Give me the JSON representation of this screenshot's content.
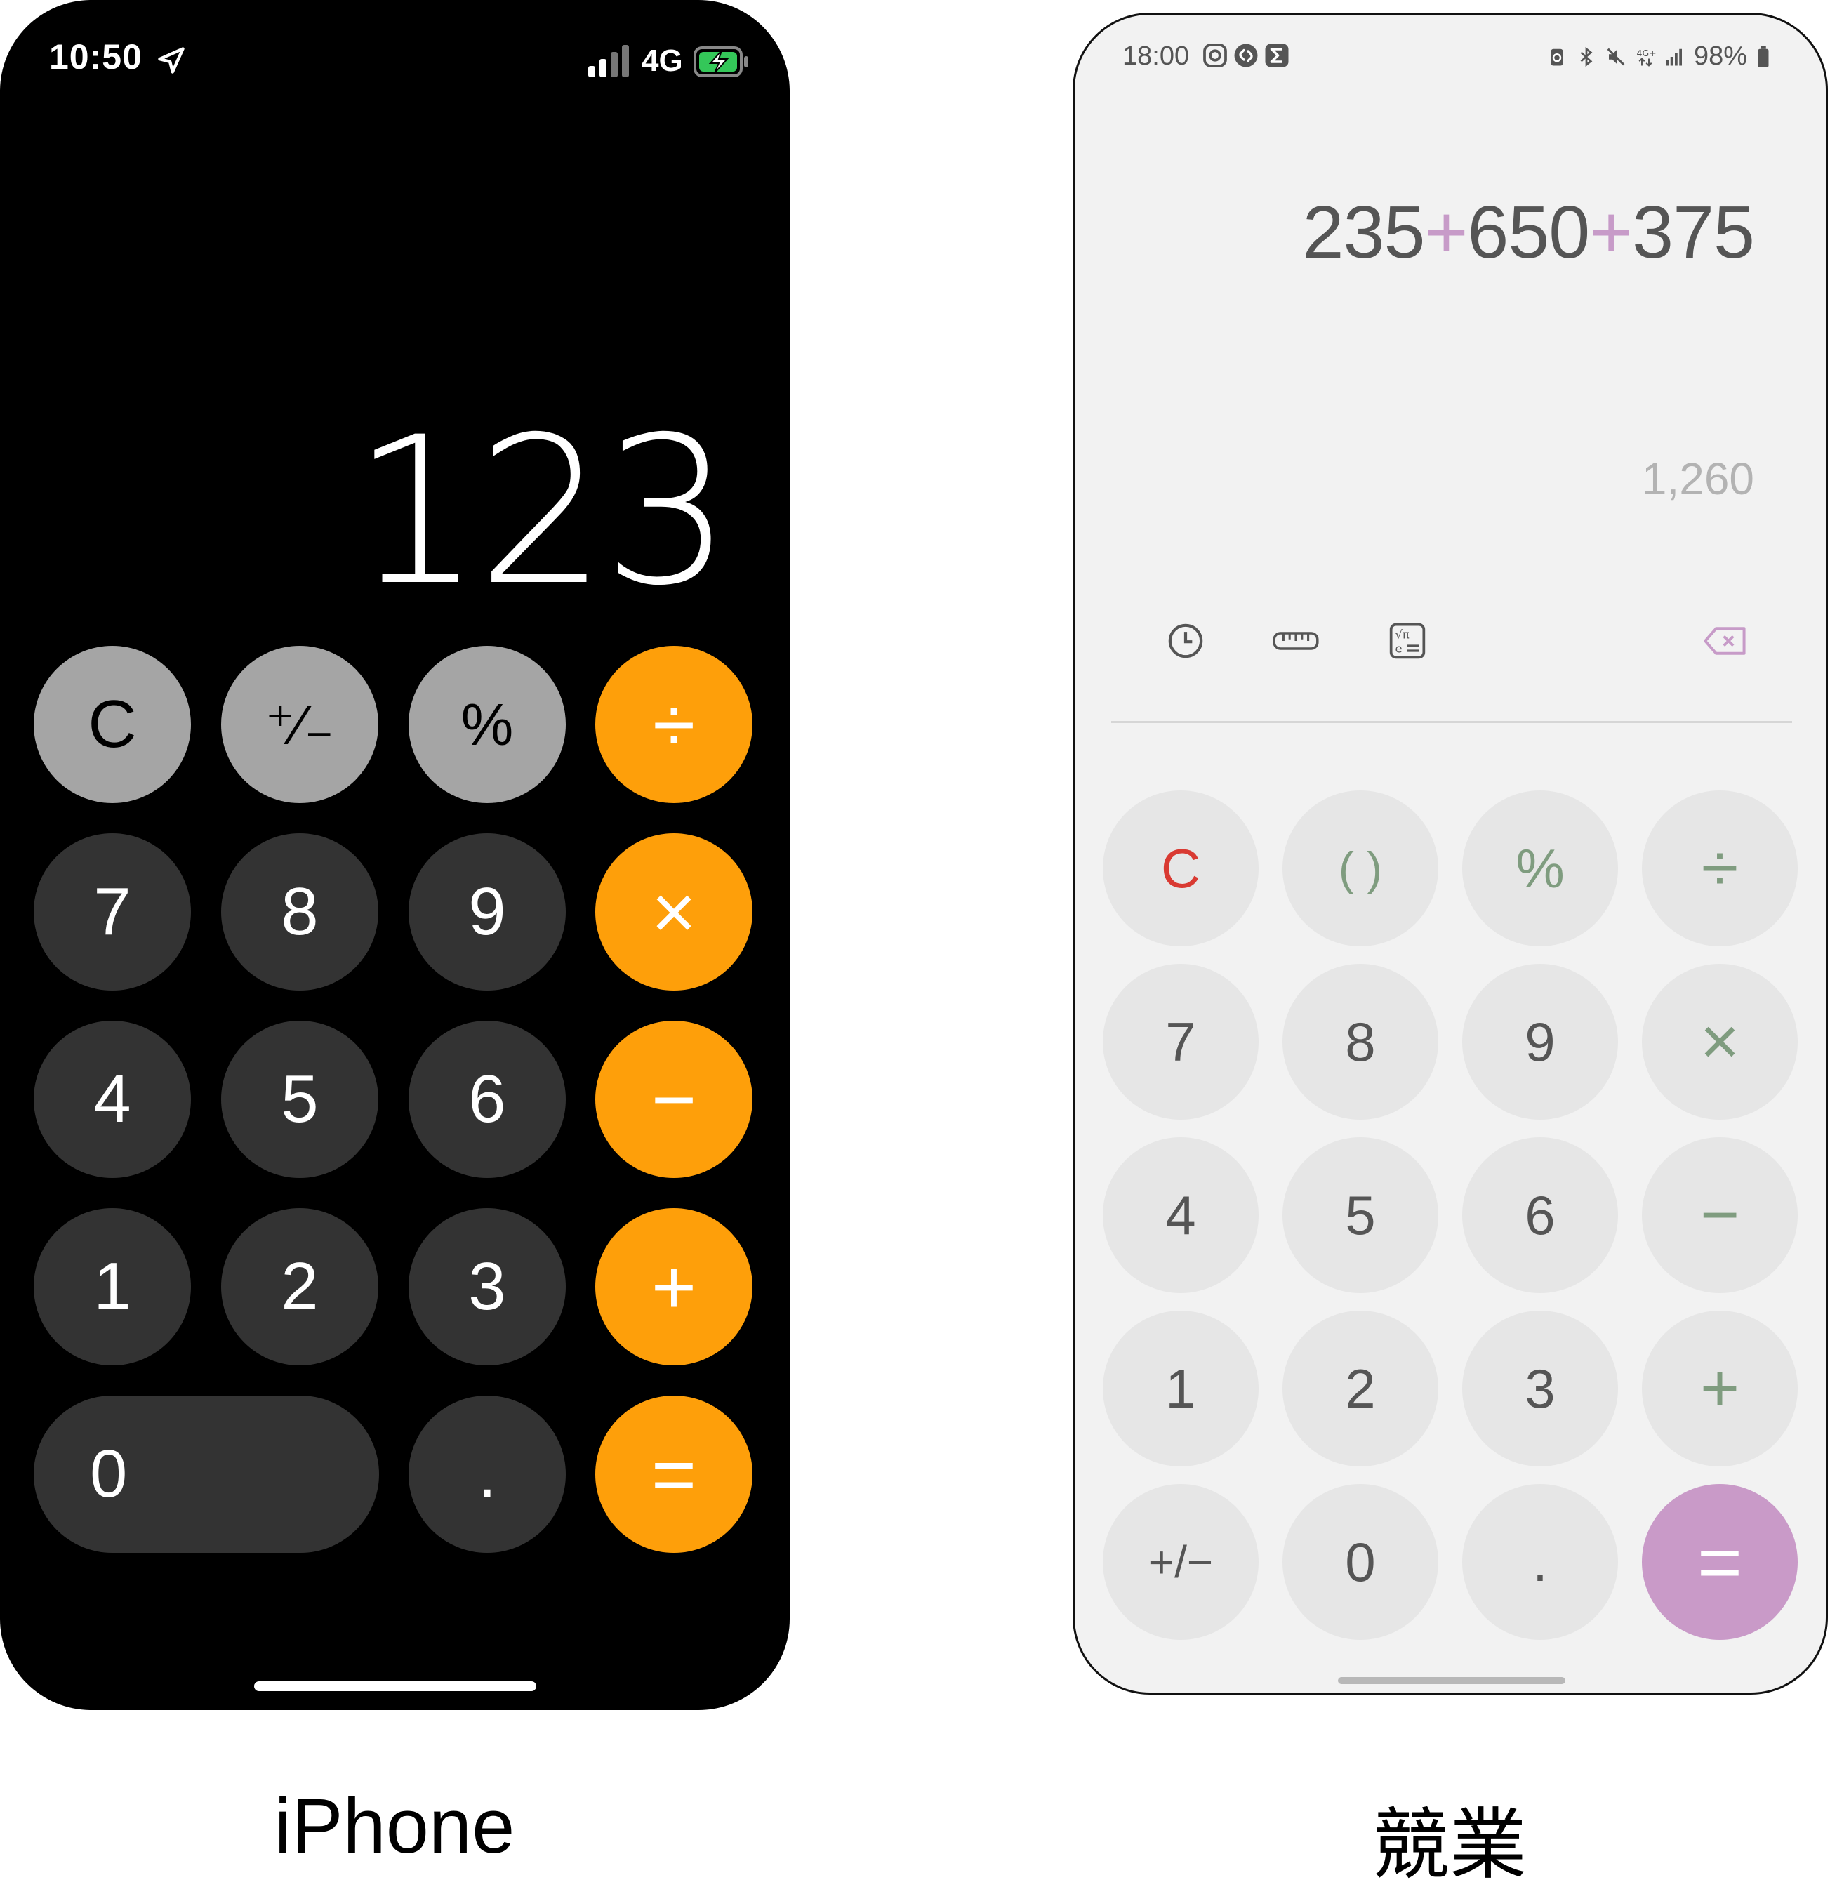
{
  "iphone": {
    "status_time": "10:50",
    "status_network": "4G",
    "display": "123",
    "keys": {
      "clear": "C",
      "sign": "⁺∕₋",
      "percent": "%",
      "divide": "÷",
      "seven": "7",
      "eight": "8",
      "nine": "9",
      "multiply": "×",
      "four": "4",
      "five": "5",
      "six": "6",
      "minus": "−",
      "one": "1",
      "two": "2",
      "three": "3",
      "plus": "+",
      "zero": "0",
      "dot": ".",
      "equals": "="
    },
    "caption": "iPhone"
  },
  "android": {
    "status_time": "18:00",
    "status_battery": "98%",
    "expression": {
      "parts": [
        "235",
        "+",
        "650",
        "+",
        "375"
      ]
    },
    "result": "1,260",
    "keys": {
      "clear": "C",
      "paren": "( )",
      "percent": "%",
      "divide": "÷",
      "seven": "7",
      "eight": "8",
      "nine": "9",
      "multiply": "×",
      "four": "4",
      "five": "5",
      "six": "6",
      "minus": "−",
      "one": "1",
      "two": "2",
      "three": "3",
      "plus": "+",
      "sign": "+/−",
      "zero": "0",
      "dot": ".",
      "equals": "="
    },
    "caption": "競業"
  },
  "colors": {
    "ios_orange": "#fe9f0a",
    "ios_gray": "#a5a5a5",
    "ios_dark": "#333333",
    "android_accent": "#c99ac8",
    "android_clear": "#d93a32",
    "android_operator": "#7f9c7f"
  },
  "icons": {
    "ios": [
      "location-arrow-icon",
      "signal-icon",
      "battery-charging-icon"
    ],
    "android_status": [
      "instagram-icon",
      "shazam-icon",
      "sigma-icon",
      "battery-saver-icon",
      "bluetooth-icon",
      "mute-icon",
      "4g-icon",
      "signal-icon",
      "battery-icon"
    ],
    "android_tools": [
      "history-icon",
      "ruler-icon",
      "scientific-icon",
      "backspace-icon"
    ]
  }
}
